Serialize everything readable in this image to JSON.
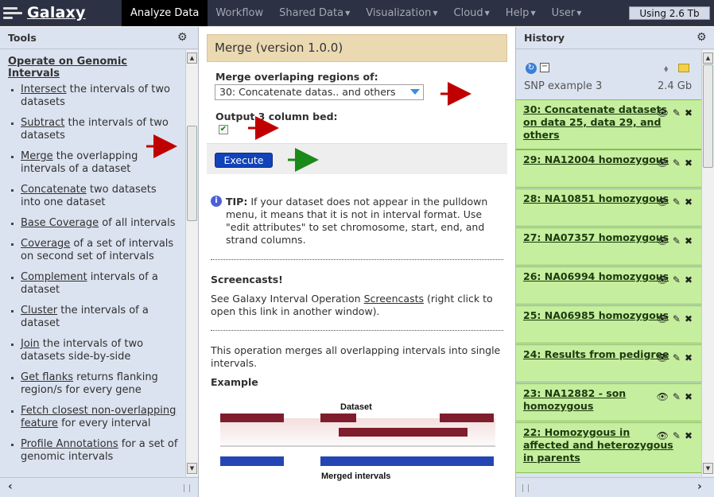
{
  "app": {
    "name": "Galaxy"
  },
  "nav": {
    "tabs": [
      {
        "label": "Analyze Data",
        "active": true
      },
      {
        "label": "Workflow"
      },
      {
        "label": "Shared Data"
      },
      {
        "label": "Visualization"
      },
      {
        "label": "Cloud"
      },
      {
        "label": "Help"
      },
      {
        "label": "User"
      }
    ],
    "quota": "Using 2.6 Tb"
  },
  "tools_panel": {
    "title": "Tools",
    "section": "Operate on Genomic Intervals",
    "items": [
      {
        "link": "Intersect",
        "rest": " the intervals of two datasets"
      },
      {
        "link": "Subtract",
        "rest": " the intervals of two datasets"
      },
      {
        "link": "Merge",
        "rest": " the overlapping intervals of a dataset"
      },
      {
        "link": "Concatenate",
        "rest": " two datasets into one dataset"
      },
      {
        "link": "Base Coverage",
        "rest": " of all intervals"
      },
      {
        "link": "Coverage",
        "rest": " of a set of intervals on second set of intervals"
      },
      {
        "link": "Complement",
        "rest": " intervals of a dataset"
      },
      {
        "link": "Cluster",
        "rest": " the intervals of a dataset"
      },
      {
        "link": "Join",
        "rest": " the intervals of two datasets side-by-side"
      },
      {
        "link": "Get flanks",
        "rest": " returns flanking region/s for every gene"
      },
      {
        "link": "Fetch closest non-overlapping feature",
        "rest": " for every interval"
      },
      {
        "link": "Profile Annotations",
        "rest": " for a set of genomic intervals"
      }
    ]
  },
  "form": {
    "title": "Merge (version 1.0.0)",
    "param1_label": "Merge overlaping regions of:",
    "param1_value": "30: Concatenate datas.. and others",
    "param2_label": "Output 3 column bed:",
    "param2_checked": true,
    "execute_label": "Execute",
    "tip_bold": "TIP:",
    "tip_text": " If your dataset does not appear in the pulldown menu, it means that it is not in interval format. Use \"edit attributes\" to set chromosome, start, end, and strand columns.",
    "screencasts_title": "Screencasts!",
    "screencasts_pre": "See Galaxy Interval Operation ",
    "screencasts_link": "Screencasts",
    "screencasts_post": " (right click to open this link in another window).",
    "description": "This operation merges all overlapping intervals into single intervals.",
    "example_title": "Example",
    "figure_dataset_label": "Dataset",
    "figure_merged_label": "Merged intervals"
  },
  "history": {
    "title": "History",
    "name": "SNP example 3",
    "size": "2.4 Gb",
    "items": [
      {
        "title": "30: Concatenate datasets on data 25, data 29, and others"
      },
      {
        "title": "29: NA12004 homozygous"
      },
      {
        "title": "28: NA10851 homozygous"
      },
      {
        "title": "27: NA07357 homozygous"
      },
      {
        "title": "26: NA06994 homozygous"
      },
      {
        "title": "25: NA06985 homozygous"
      },
      {
        "title": "24: Results from pedigree"
      },
      {
        "title": "23: NA12882 - son homozygous"
      },
      {
        "title": "22: Homozygous in affected and heterozygous in parents"
      }
    ]
  },
  "colors": {
    "masthead": "#2c3143",
    "panel": "#dce3f0",
    "history_ok": "#c5ee9e",
    "form_header": "#ebd9b2",
    "execute": "#1243ba",
    "annotation_red": "#c00000",
    "annotation_green": "#1a8a1a"
  }
}
